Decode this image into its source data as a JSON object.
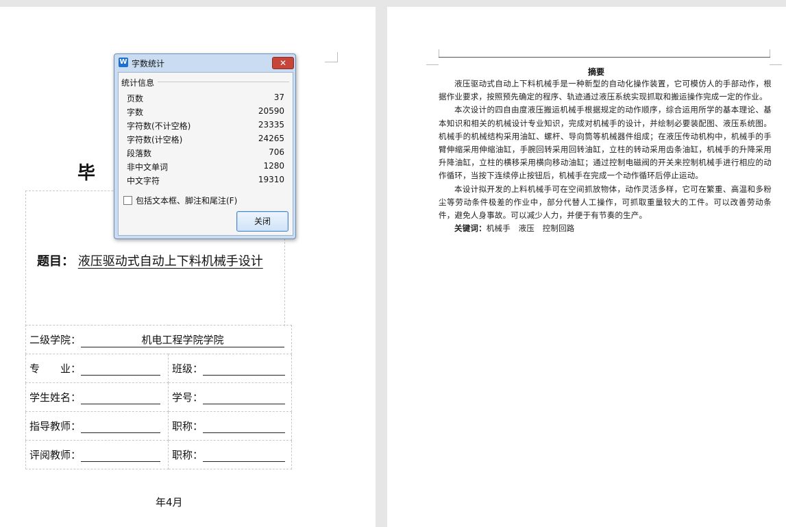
{
  "cover": {
    "big_char": "毕",
    "title_label": "题目",
    "title_colon": "：",
    "title_text": "液压驱动式自动上下料机械手设计",
    "fields": {
      "college_label": "二级学院：",
      "college_value": "机电工程学院学院",
      "major_label": "专　　业：",
      "class_label": "班级：",
      "student_label": "学生姓名：",
      "id_label": "学号：",
      "advisor_label": "指导教师：",
      "advisor_title_label": "职称：",
      "reviewer_label": "评阅教师：",
      "reviewer_title_label": "职称："
    },
    "date": "年4月"
  },
  "abstract": {
    "heading": "摘要",
    "paragraphs": [
      "液压驱动式自动上下料机械手是一种新型的自动化操作装置，它可模仿人的手部动作，根据作业要求，按照预先确定的程序、轨迹通过液压系统实现抓取和搬运操作完成一定的作业。",
      "本次设计的四自由度液压搬运机械手根据规定的动作顺序，综合运用所学的基本理论、基本知识和相关的机械设计专业知识，完成对机械手的设计，并绘制必要装配图、液压系统图。机械手的机械结构采用油缸、螺杆、导向筒等机械器件组成；在液压传动机构中，机械手的手臂伸缩采用伸缩油缸，手腕回转采用回转油缸，立柱的转动采用齿条油缸，机械手的升降采用升降油缸，立柱的横移采用横向移动油缸；通过控制电磁阀的开关来控制机械手进行相应的动作循环，当按下连续停止按钮后，机械手在完成一个动作循环后停止运动。",
      "本设计拟开发的上料机械手可在空间抓放物体，动作灵活多样，它可在繁重、高温和多粉尘等劳动条件极差的作业中，部分代替人工操作，可抓取重量较大的工件。可以改善劳动条件，避免人身事故。可以减少人力，并便于有节奏的生产。"
    ],
    "keywords_label": "关键词：",
    "keywords": "机械手　液压　控制回路"
  },
  "dialog": {
    "title": "字数统计",
    "app_icon": "W",
    "close_glyph": "✕",
    "group_label": "统计信息",
    "stats": [
      {
        "label": "页数",
        "value": "37"
      },
      {
        "label": "字数",
        "value": "20590"
      },
      {
        "label": "字符数(不计空格)",
        "value": "23335"
      },
      {
        "label": "字符数(计空格)",
        "value": "24265"
      },
      {
        "label": "段落数",
        "value": "706"
      },
      {
        "label": "非中文单词",
        "value": "1280"
      },
      {
        "label": "中文字符",
        "value": "19310"
      }
    ],
    "checkbox_label": "包括文本框、脚注和尾注(F)",
    "checkbox_checked": false,
    "close_button": "关闭",
    "icons": {
      "app": "wps-writer-icon",
      "close": "close-icon"
    }
  }
}
